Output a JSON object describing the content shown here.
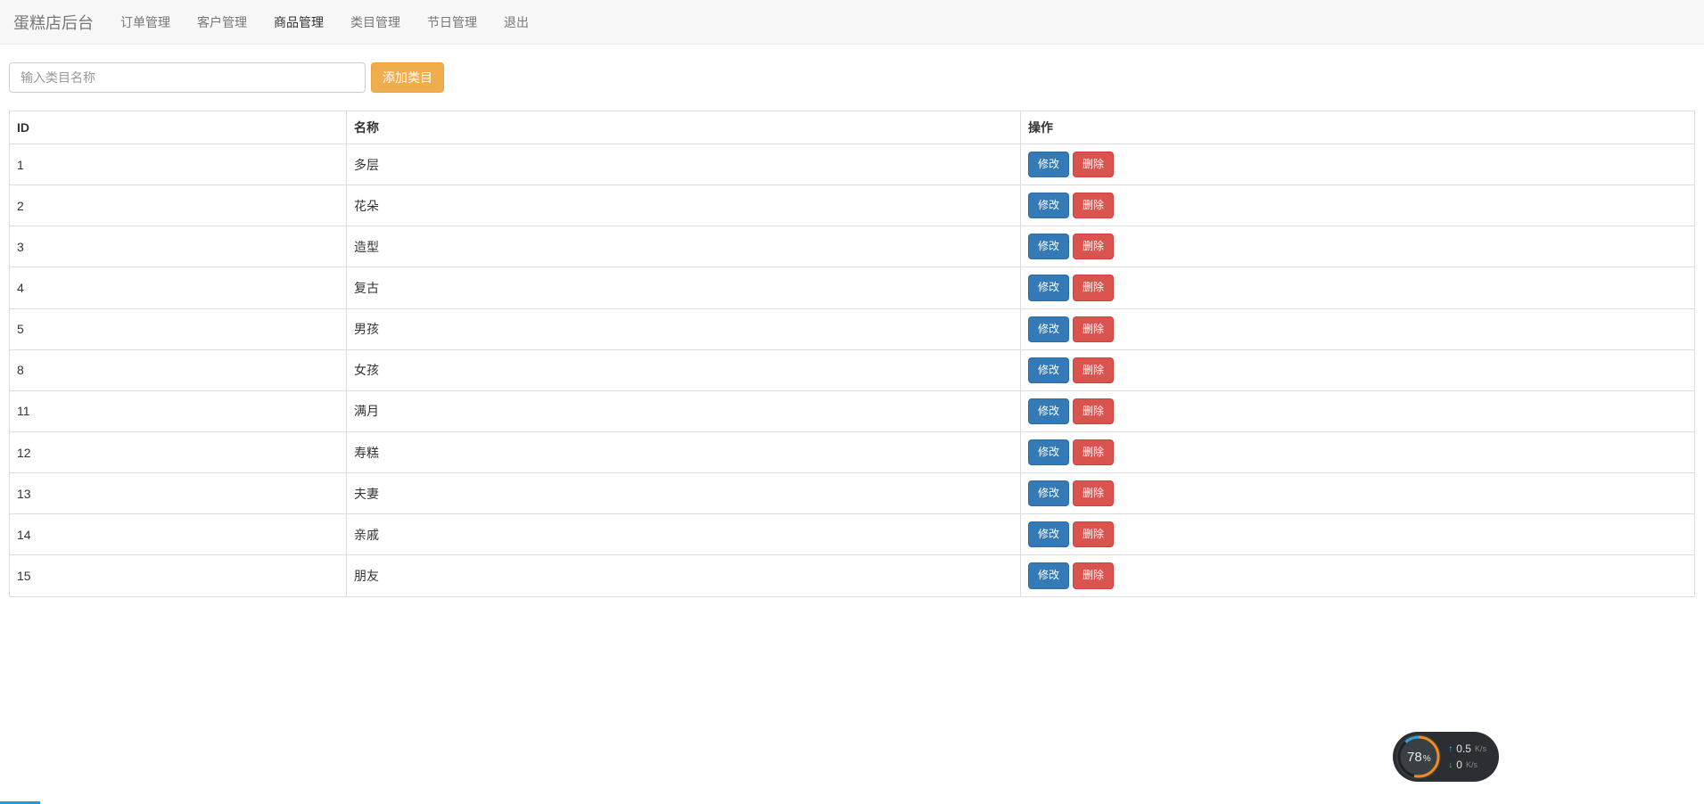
{
  "nav": {
    "brand": "蛋糕店后台",
    "items": [
      {
        "label": "订单管理",
        "active": false
      },
      {
        "label": "客户管理",
        "active": false
      },
      {
        "label": "商品管理",
        "active": true
      },
      {
        "label": "类目管理",
        "active": false
      },
      {
        "label": "节日管理",
        "active": false
      },
      {
        "label": "退出",
        "active": false
      }
    ]
  },
  "form": {
    "category_input_placeholder": "输入类目名称",
    "add_button_label": "添加类目"
  },
  "table": {
    "headers": {
      "id": "ID",
      "name": "名称",
      "action": "操作"
    },
    "edit_label": "修改",
    "delete_label": "删除",
    "rows": [
      {
        "id": "1",
        "name": "多层"
      },
      {
        "id": "2",
        "name": "花朵"
      },
      {
        "id": "3",
        "name": "造型"
      },
      {
        "id": "4",
        "name": "复古"
      },
      {
        "id": "5",
        "name": "男孩"
      },
      {
        "id": "8",
        "name": "女孩"
      },
      {
        "id": "11",
        "name": "满月"
      },
      {
        "id": "12",
        "name": "寿糕"
      },
      {
        "id": "13",
        "name": "夫妻"
      },
      {
        "id": "14",
        "name": "亲戚"
      },
      {
        "id": "15",
        "name": "朋友"
      }
    ]
  },
  "widget": {
    "percent": "78",
    "percent_sign": "%",
    "up_speed": "0.5",
    "down_speed": "0",
    "unit": "K/s"
  }
}
